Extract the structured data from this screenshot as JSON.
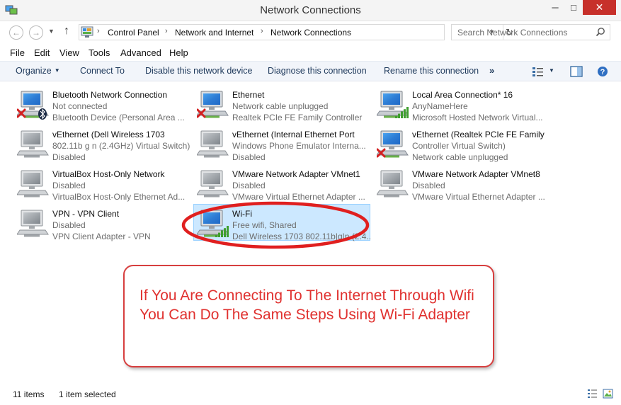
{
  "window": {
    "title": "Network Connections",
    "minimize_glyph": "─",
    "maximize_glyph": "□",
    "close_glyph": "✕"
  },
  "nav": {
    "back_glyph": "←",
    "forward_glyph": "→",
    "recent_glyph": "▼",
    "up_glyph": "↑",
    "breadcrumb": [
      "Control Panel",
      "Network and Internet",
      "Network Connections"
    ],
    "breadcrumb_sep": "›",
    "dropdown_glyph": "▼",
    "refresh_glyph": "↻"
  },
  "search": {
    "placeholder": "Search Network Connections"
  },
  "menu": [
    "File",
    "Edit",
    "View",
    "Tools",
    "Advanced",
    "Help"
  ],
  "toolbar": {
    "organize": "Organize",
    "organize_caret": "▼",
    "connect": "Connect To",
    "disable": "Disable this network device",
    "diagnose": "Diagnose this connection",
    "rename": "Rename this connection",
    "more": "»",
    "view_caret": "▼"
  },
  "connections": [
    {
      "name": "Bluetooth Network Connection",
      "status": "Not connected",
      "device": "Bluetooth Device (Personal Area ...",
      "badge": "x",
      "extra": "bluetooth",
      "selected": false
    },
    {
      "name": "Ethernet",
      "status": "Network cable unplugged",
      "device": "Realtek PCIe FE Family Controller",
      "badge": "x",
      "selected": false
    },
    {
      "name": "Local Area Connection* 16",
      "status": "AnyNameHere",
      "device": "Microsoft Hosted Network Virtual...",
      "badge": "signal",
      "selected": false
    },
    {
      "name": "vEthernet (Dell Wireless 1703",
      "status": "802.11b g n (2.4GHz) Virtual Switch)",
      "device": "Disabled",
      "badge": "disabled",
      "selected": false
    },
    {
      "name": "vEthernet (Internal Ethernet Port",
      "status": "Windows Phone Emulator Interna...",
      "device": "Disabled",
      "badge": "disabled",
      "selected": false
    },
    {
      "name": "vEthernet (Realtek PCIe FE Family",
      "status": "Controller Virtual Switch)",
      "device": "Network cable unplugged",
      "badge": "x",
      "selected": false
    },
    {
      "name": "VirtualBox Host-Only Network",
      "status": "Disabled",
      "device": "VirtualBox Host-Only Ethernet Ad...",
      "badge": "disabled",
      "selected": false
    },
    {
      "name": "VMware Network Adapter VMnet1",
      "status": "Disabled",
      "device": "VMware Virtual Ethernet Adapter ...",
      "badge": "disabled",
      "selected": false
    },
    {
      "name": "VMware Network Adapter VMnet8",
      "status": "Disabled",
      "device": "VMware Virtual Ethernet Adapter ...",
      "badge": "disabled",
      "selected": false
    },
    {
      "name": "VPN - VPN Client",
      "status": "Disabled",
      "device": "VPN Client Adapter - VPN",
      "badge": "disabled",
      "selected": false
    },
    {
      "name": "Wi-Fi",
      "status": "Free wifi, Shared",
      "device": "Dell Wireless 1703 802.11b|g|n (2.4...",
      "badge": "signal",
      "selected": true
    }
  ],
  "annotation": {
    "text": "If You Are Connecting To The Internet Through Wifi You Can Do The Same Steps Using Wi-Fi Adapter",
    "color": "#e0312f"
  },
  "status": {
    "count": "11 items",
    "selected": "1 item selected"
  },
  "colors": {
    "selection_bg": "#cce8ff",
    "selection_border": "#99d1ff",
    "close_button": "#c7302a",
    "command_text": "#1e395b"
  }
}
